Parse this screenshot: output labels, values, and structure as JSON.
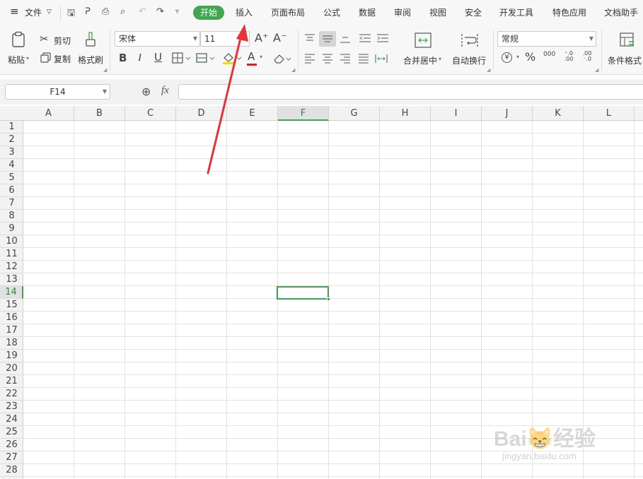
{
  "menubar": {
    "menu_icon": "≡",
    "file_label": "文件",
    "quick_access": {
      "save": "🖫",
      "format_painter": "ᕈ",
      "print": "⎙",
      "preview": "⌕",
      "undo": "↶",
      "redo": "↷",
      "more": "▿"
    },
    "tabs": [
      "开始",
      "插入",
      "页面布局",
      "公式",
      "数据",
      "审阅",
      "视图",
      "安全",
      "开发工具",
      "特色应用",
      "文档助手"
    ]
  },
  "ribbon": {
    "paste_label": "粘贴",
    "cut_label": "剪切",
    "copy_label": "复制",
    "format_painter_label": "格式刷",
    "font_name": "宋体",
    "font_size": "11",
    "bold": "B",
    "italic": "I",
    "underline": "U",
    "font_color_glyph": "A",
    "grow_glyph": "A⁺",
    "shrink_glyph": "A⁻",
    "merge_label": "合并居中",
    "wrap_label": "自动换行",
    "number_format": "常规",
    "currency": "¥",
    "percent": "%",
    "thousands": "000",
    "inc_decimal": "⁺.0 .00",
    "dec_decimal": ".00 ⁻.0",
    "conditional_label": "条件格式"
  },
  "formula_bar": {
    "name_box": "F14",
    "fx_label": "fx",
    "zoom_icon": "⊕",
    "value": ""
  },
  "sheet": {
    "columns": [
      "A",
      "B",
      "C",
      "D",
      "E",
      "F",
      "G",
      "H",
      "I",
      "J",
      "K",
      "L"
    ],
    "rows": [
      "1",
      "2",
      "3",
      "4",
      "5",
      "6",
      "7",
      "8",
      "9",
      "10",
      "11",
      "12",
      "13",
      "14",
      "15",
      "16",
      "17",
      "18",
      "19",
      "20",
      "21",
      "22",
      "23",
      "24",
      "25",
      "26",
      "27",
      "28"
    ],
    "selected_column": "F",
    "selected_row": "14",
    "accent_color": "#40a650"
  },
  "annotation": {
    "arrow_color": "#e8323a"
  },
  "watermark": {
    "text": "Bai😸经验",
    "sub": "jingyan.baidu.com"
  }
}
